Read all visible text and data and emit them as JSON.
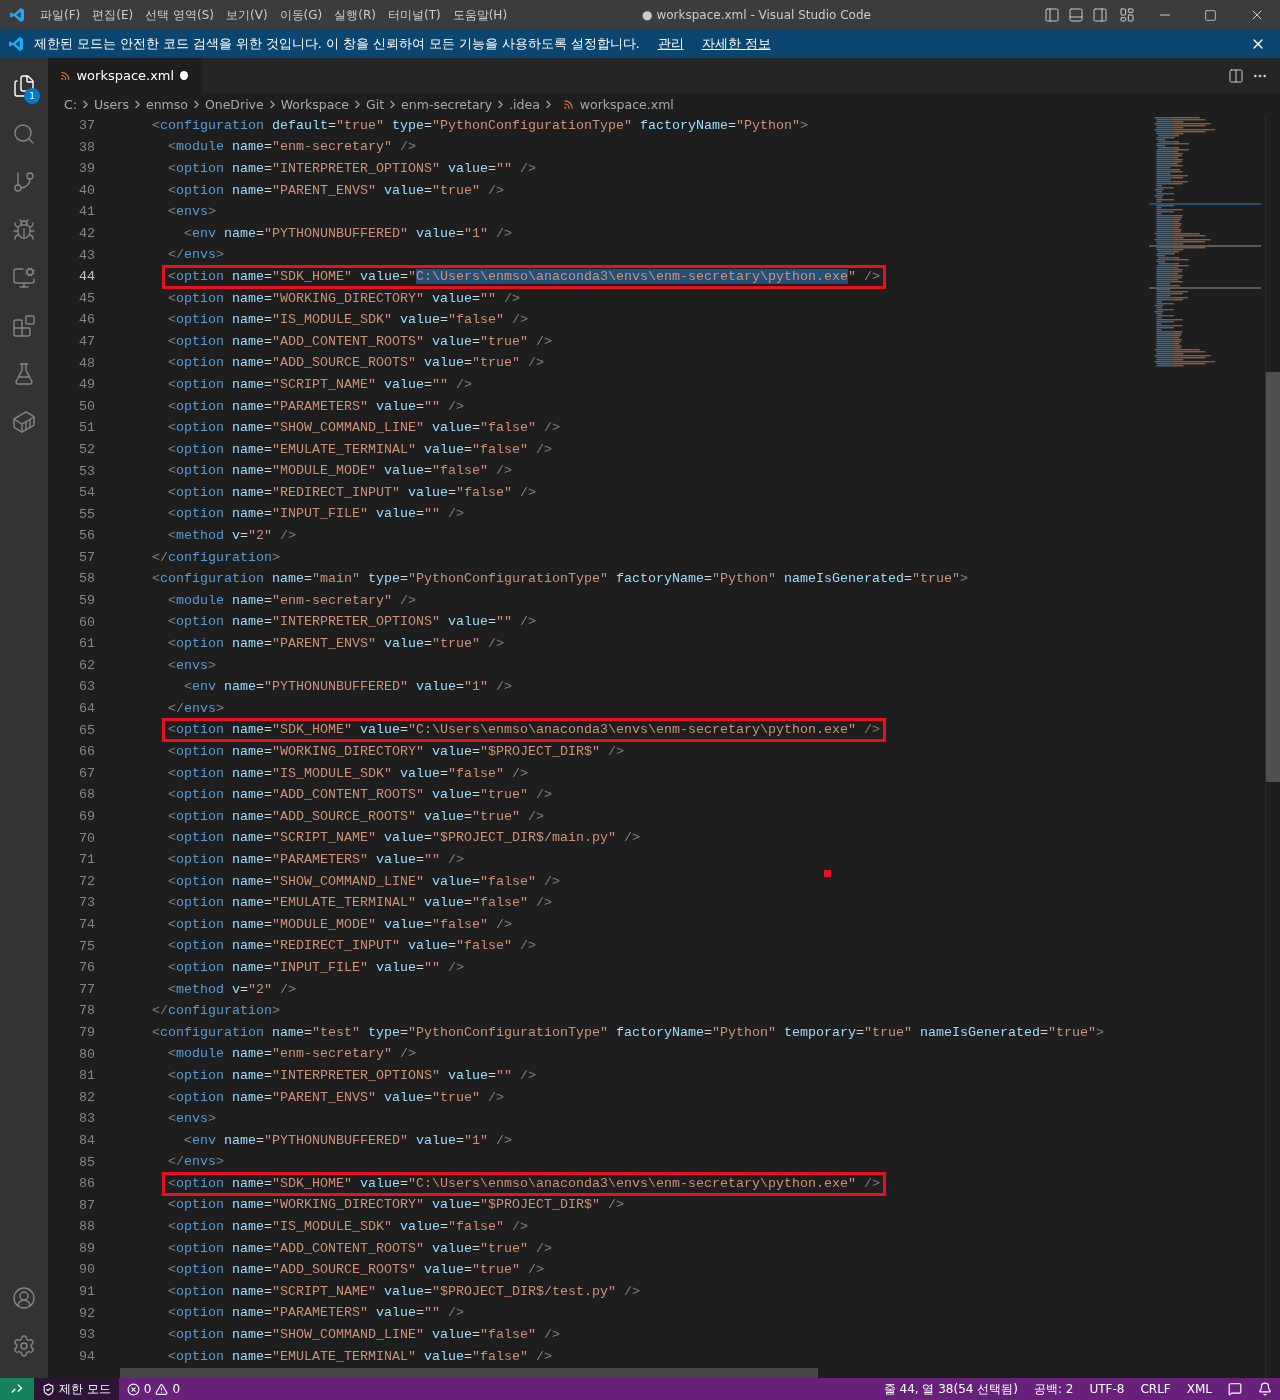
{
  "title_bar": {
    "menu": [
      "파일(F)",
      "편집(E)",
      "선택 영역(S)",
      "보기(V)",
      "이동(G)",
      "실행(R)",
      "터미널(T)",
      "도움말(H)"
    ],
    "title": "● workspace.xml - Visual Studio Code"
  },
  "banner": {
    "message": "제한된 모드는 안전한 코드 검색을 위한 것입니다. 이 창을 신뢰하여 모든 기능을 사용하도록 설정합니다.",
    "links": [
      "관리",
      "자세한 정보"
    ]
  },
  "activity_bar": {
    "explorer_badge": "1"
  },
  "tabs": [
    {
      "label": "workspace.xml",
      "selected": true,
      "dirty": true
    }
  ],
  "breadcrumbs": [
    "C:",
    "Users",
    "enmso",
    "OneDrive",
    "Workspace",
    "Git",
    "enm-secretary",
    ".idea",
    "workspace.xml"
  ],
  "editor": {
    "lines": [
      {
        "number": "37",
        "code": "    <configuration default=\"true\" type=\"PythonConfigurationType\" factoryName=\"Python\">",
        "current": false,
        "boxed": false
      },
      {
        "number": "38",
        "code": "      <module name=\"enm-secretary\" />",
        "current": false,
        "boxed": false
      },
      {
        "number": "39",
        "code": "      <option name=\"INTERPRETER_OPTIONS\" value=\"\" />",
        "current": false,
        "boxed": false
      },
      {
        "number": "40",
        "code": "      <option name=\"PARENT_ENVS\" value=\"true\" />",
        "current": false,
        "boxed": false
      },
      {
        "number": "41",
        "code": "      <envs>",
        "current": false,
        "boxed": false
      },
      {
        "number": "42",
        "code": "        <env name=\"PYTHONUNBUFFERED\" value=\"1\" />",
        "current": false,
        "boxed": false
      },
      {
        "number": "43",
        "code": "      </envs>",
        "current": false,
        "boxed": false
      },
      {
        "number": "44",
        "code": "      <option name=\"SDK_HOME\" value=\"",
        "selection": "C:\\Users\\enmso\\anaconda3\\envs\\enm-secretary\\python.exe",
        "code_after": "\" />",
        "current": true,
        "boxed": true
      },
      {
        "number": "45",
        "code": "      <option name=\"WORKING_DIRECTORY\" value=\"\" />",
        "current": false,
        "boxed": false
      },
      {
        "number": "46",
        "code": "      <option name=\"IS_MODULE_SDK\" value=\"false\" />",
        "current": false,
        "boxed": false
      },
      {
        "number": "47",
        "code": "      <option name=\"ADD_CONTENT_ROOTS\" value=\"true\" />",
        "current": false,
        "boxed": false
      },
      {
        "number": "48",
        "code": "      <option name=\"ADD_SOURCE_ROOTS\" value=\"true\" />",
        "current": false,
        "boxed": false
      },
      {
        "number": "49",
        "code": "      <option name=\"SCRIPT_NAME\" value=\"\" />",
        "current": false,
        "boxed": false
      },
      {
        "number": "50",
        "code": "      <option name=\"PARAMETERS\" value=\"\" />",
        "current": false,
        "boxed": false
      },
      {
        "number": "51",
        "code": "      <option name=\"SHOW_COMMAND_LINE\" value=\"false\" />",
        "current": false,
        "boxed": false
      },
      {
        "number": "52",
        "code": "      <option name=\"EMULATE_TERMINAL\" value=\"false\" />",
        "current": false,
        "boxed": false
      },
      {
        "number": "53",
        "code": "      <option name=\"MODULE_MODE\" value=\"false\" />",
        "current": false,
        "boxed": false
      },
      {
        "number": "54",
        "code": "      <option name=\"REDIRECT_INPUT\" value=\"false\" />",
        "current": false,
        "boxed": false
      },
      {
        "number": "55",
        "code": "      <option name=\"INPUT_FILE\" value=\"\" />",
        "current": false,
        "boxed": false
      },
      {
        "number": "56",
        "code": "      <method v=\"2\" />",
        "current": false,
        "boxed": false
      },
      {
        "number": "57",
        "code": "    </configuration>",
        "current": false,
        "boxed": false
      },
      {
        "number": "58",
        "code": "    <configuration name=\"main\" type=\"PythonConfigurationType\" factoryName=\"Python\" nameIsGenerated=\"true\">",
        "current": false,
        "boxed": false
      },
      {
        "number": "59",
        "code": "      <module name=\"enm-secretary\" />",
        "current": false,
        "boxed": false
      },
      {
        "number": "60",
        "code": "      <option name=\"INTERPRETER_OPTIONS\" value=\"\" />",
        "current": false,
        "boxed": false
      },
      {
        "number": "61",
        "code": "      <option name=\"PARENT_ENVS\" value=\"true\" />",
        "current": false,
        "boxed": false
      },
      {
        "number": "62",
        "code": "      <envs>",
        "current": false,
        "boxed": false
      },
      {
        "number": "63",
        "code": "        <env name=\"PYTHONUNBUFFERED\" value=\"1\" />",
        "current": false,
        "boxed": false
      },
      {
        "number": "64",
        "code": "      </envs>",
        "current": false,
        "boxed": false
      },
      {
        "number": "65",
        "code": "      <option name=\"SDK_HOME\" value=\"C:\\Users\\enmso\\anaconda3\\envs\\enm-secretary\\python.exe\" />",
        "current": false,
        "boxed": true
      },
      {
        "number": "66",
        "code": "      <option name=\"WORKING_DIRECTORY\" value=\"$PROJECT_DIR$\" />",
        "current": false,
        "boxed": false
      },
      {
        "number": "67",
        "code": "      <option name=\"IS_MODULE_SDK\" value=\"false\" />",
        "current": false,
        "boxed": false
      },
      {
        "number": "68",
        "code": "      <option name=\"ADD_CONTENT_ROOTS\" value=\"true\" />",
        "current": false,
        "boxed": false
      },
      {
        "number": "69",
        "code": "      <option name=\"ADD_SOURCE_ROOTS\" value=\"true\" />",
        "current": false,
        "boxed": false
      },
      {
        "number": "70",
        "code": "      <option name=\"SCRIPT_NAME\" value=\"$PROJECT_DIR$/main.py\" />",
        "current": false,
        "boxed": false
      },
      {
        "number": "71",
        "code": "      <option name=\"PARAMETERS\" value=\"\" />",
        "current": false,
        "boxed": false
      },
      {
        "number": "72",
        "code": "      <option name=\"SHOW_COMMAND_LINE\" value=\"false\" />",
        "current": false,
        "boxed": false
      },
      {
        "number": "73",
        "code": "      <option name=\"EMULATE_TERMINAL\" value=\"false\" />",
        "current": false,
        "boxed": false
      },
      {
        "number": "74",
        "code": "      <option name=\"MODULE_MODE\" value=\"false\" />",
        "current": false,
        "boxed": false
      },
      {
        "number": "75",
        "code": "      <option name=\"REDIRECT_INPUT\" value=\"false\" />",
        "current": false,
        "boxed": false
      },
      {
        "number": "76",
        "code": "      <option name=\"INPUT_FILE\" value=\"\" />",
        "current": false,
        "boxed": false
      },
      {
        "number": "77",
        "code": "      <method v=\"2\" />",
        "current": false,
        "boxed": false
      },
      {
        "number": "78",
        "code": "    </configuration>",
        "current": false,
        "boxed": false
      },
      {
        "number": "79",
        "code": "    <configuration name=\"test\" type=\"PythonConfigurationType\" factoryName=\"Python\" temporary=\"true\" nameIsGenerated=\"true\">",
        "current": false,
        "boxed": false
      },
      {
        "number": "80",
        "code": "      <module name=\"enm-secretary\" />",
        "current": false,
        "boxed": false
      },
      {
        "number": "81",
        "code": "      <option name=\"INTERPRETER_OPTIONS\" value=\"\" />",
        "current": false,
        "boxed": false
      },
      {
        "number": "82",
        "code": "      <option name=\"PARENT_ENVS\" value=\"true\" />",
        "current": false,
        "boxed": false
      },
      {
        "number": "83",
        "code": "      <envs>",
        "current": false,
        "boxed": false
      },
      {
        "number": "84",
        "code": "        <env name=\"PYTHONUNBUFFERED\" value=\"1\" />",
        "current": false,
        "boxed": false
      },
      {
        "number": "85",
        "code": "      </envs>",
        "current": false,
        "boxed": false
      },
      {
        "number": "86",
        "code": "      <option name=\"SDK_HOME\" value=\"C:\\Users\\enmso\\anaconda3\\envs\\enm-secretary\\python.exe\" />",
        "current": false,
        "boxed": true
      },
      {
        "number": "87",
        "code": "      <option name=\"WORKING_DIRECTORY\" value=\"$PROJECT_DIR$\" />",
        "current": false,
        "boxed": false
      },
      {
        "number": "88",
        "code": "      <option name=\"IS_MODULE_SDK\" value=\"false\" />",
        "current": false,
        "boxed": false
      },
      {
        "number": "89",
        "code": "      <option name=\"ADD_CONTENT_ROOTS\" value=\"true\" />",
        "current": false,
        "boxed": false
      },
      {
        "number": "90",
        "code": "      <option name=\"ADD_SOURCE_ROOTS\" value=\"true\" />",
        "current": false,
        "boxed": false
      },
      {
        "number": "91",
        "code": "      <option name=\"SCRIPT_NAME\" value=\"$PROJECT_DIR$/test.py\" />",
        "current": false,
        "boxed": false
      },
      {
        "number": "92",
        "code": "      <option name=\"PARAMETERS\" value=\"\" />",
        "current": false,
        "boxed": false
      },
      {
        "number": "93",
        "code": "      <option name=\"SHOW_COMMAND_LINE\" value=\"false\" />",
        "current": false,
        "boxed": false
      },
      {
        "number": "94",
        "code": "      <option name=\"EMULATE_TERMINAL\" value=\"false\" />",
        "current": false,
        "boxed": false
      }
    ]
  },
  "status_bar": {
    "mode": "제한 모드",
    "errors": "0",
    "warnings": "0",
    "right": [
      "줄 44, 열 38(54 선택됨)",
      "공백: 2",
      "UTF-8",
      "CRLF",
      "XML"
    ]
  }
}
